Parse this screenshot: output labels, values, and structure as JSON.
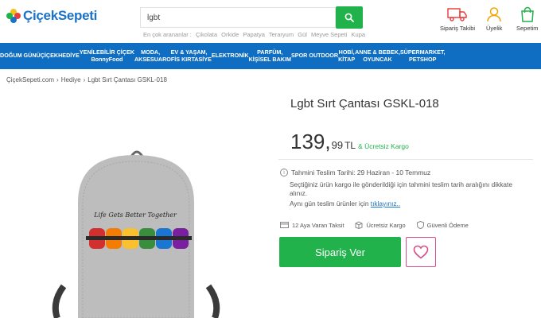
{
  "header": {
    "logo_text": "ÇiçekSepeti",
    "search_value": "lgbt",
    "suggestions_label": "En çok arananlar :",
    "suggestions": [
      "Çikolata",
      "Orkide",
      "Papatya",
      "Teraryum",
      "Gül",
      "Meyve Sepeti",
      "Kupa"
    ],
    "order_tracking": "Sipariş Takibi",
    "membership": "Üyelik",
    "cart": "Sepetim"
  },
  "nav": [
    {
      "label": "DOĞUM GÜNÜ"
    },
    {
      "label": "ÇİÇEK"
    },
    {
      "label": "HEDİYE"
    },
    {
      "label": "YENİLEBİLİR ÇİÇEK\nBonnyFood"
    },
    {
      "label": "MODA,\nAKSESUAR"
    },
    {
      "label": "EV & YAŞAM,\nOFİS KIRTASİYE"
    },
    {
      "label": "ELEKTRONİK"
    },
    {
      "label": "PARFÜM,\nKİŞİSEL BAKIM"
    },
    {
      "label": "SPOR OUTDOOR"
    },
    {
      "label": "HOBİ,\nKİTAP"
    },
    {
      "label": "ANNE & BEBEK,\nOYUNCAK"
    },
    {
      "label": "SÜPERMARKET,\nPETSHOP"
    }
  ],
  "breadcrumb": [
    "ÇiçekSepeti.com",
    "Hediye",
    "Lgbt Sırt Çantası GSKL-018"
  ],
  "product": {
    "title": "Lgbt Sırt Çantası GSKL-018",
    "price_main": "139,",
    "price_dec": "99",
    "currency": "TL",
    "free_cargo": "& Ücretsiz Kargo",
    "delivery": "Tahmini Teslim Tarihi: 29 Haziran - 10 Temmuz",
    "delivery_note": "Seçtiğiniz ürün kargo ile gönderildiği için tahmini teslim tarih aralığını dikkate alınız.",
    "sameday_text": "Aynı gün teslim ürünler için",
    "sameday_link": "tıklayınız..",
    "features": [
      "12 Aya Varan Taksit",
      "Ücretsiz Kargo",
      "Güvenli Ödeme"
    ],
    "order_button": "Sipariş Ver",
    "bag_text": "Life Gets Better Together"
  },
  "colors": {
    "brand_blue": "#0f6ec2",
    "green": "#21b24b",
    "pink": "#d94c8a"
  }
}
